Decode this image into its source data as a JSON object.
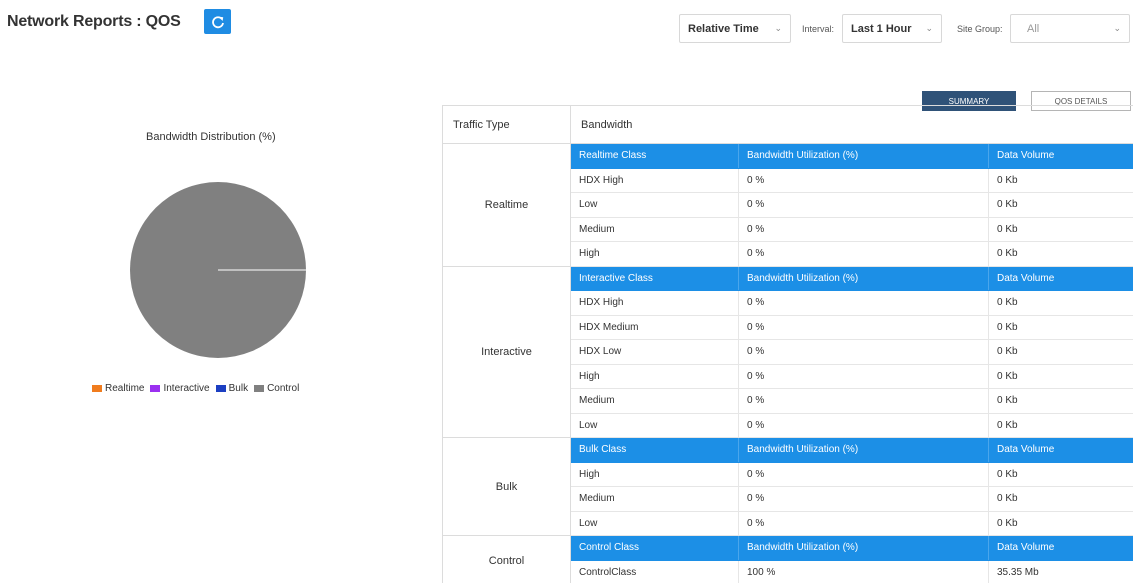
{
  "header": {
    "title": "Network Reports : QOS",
    "refresh_icon": "refresh-icon"
  },
  "filters": {
    "time_mode": "Relative Time",
    "interval_label": "Interval:",
    "interval_value": "Last 1 Hour",
    "site_group_label": "Site Group:",
    "site_group_value": "All"
  },
  "view_buttons": {
    "summary": "SUMMARY",
    "qos_details": "QOS DETAILS"
  },
  "chart": {
    "title": "Bandwidth Distribution (%)",
    "legend": [
      {
        "label": "Realtime",
        "color": "#f07c1e"
      },
      {
        "label": "Interactive",
        "color": "#9b30f0"
      },
      {
        "label": "Bulk",
        "color": "#1c3fc2"
      },
      {
        "label": "Control",
        "color": "#808080"
      }
    ]
  },
  "chart_data": {
    "type": "pie",
    "title": "Bandwidth Distribution (%)",
    "categories": [
      "Realtime",
      "Interactive",
      "Bulk",
      "Control"
    ],
    "values": [
      0,
      0,
      0,
      100
    ],
    "colors": [
      "#f07c1e",
      "#9b30f0",
      "#1c3fc2",
      "#808080"
    ],
    "legend_position": "bottom"
  },
  "table": {
    "headers": {
      "traffic_type": "Traffic Type",
      "bandwidth": "Bandwidth"
    },
    "groups": [
      {
        "name": "Realtime",
        "class_header": [
          "Realtime Class",
          "Bandwidth Utilization (%)",
          "Data Volume"
        ],
        "rows": [
          [
            "HDX High",
            "0 %",
            "0 Kb"
          ],
          [
            "Low",
            "0 %",
            "0 Kb"
          ],
          [
            "Medium",
            "0 %",
            "0 Kb"
          ],
          [
            "High",
            "0 %",
            "0 Kb"
          ]
        ]
      },
      {
        "name": "Interactive",
        "class_header": [
          "Interactive Class",
          "Bandwidth Utilization (%)",
          "Data Volume"
        ],
        "rows": [
          [
            "HDX High",
            "0 %",
            "0 Kb"
          ],
          [
            "HDX Medium",
            "0 %",
            "0 Kb"
          ],
          [
            "HDX Low",
            "0 %",
            "0 Kb"
          ],
          [
            "High",
            "0 %",
            "0 Kb"
          ],
          [
            "Medium",
            "0 %",
            "0 Kb"
          ],
          [
            "Low",
            "0 %",
            "0 Kb"
          ]
        ]
      },
      {
        "name": "Bulk",
        "class_header": [
          "Bulk Class",
          "Bandwidth Utilization (%)",
          "Data Volume"
        ],
        "rows": [
          [
            "High",
            "0 %",
            "0 Kb"
          ],
          [
            "Medium",
            "0 %",
            "0 Kb"
          ],
          [
            "Low",
            "0 %",
            "0 Kb"
          ]
        ]
      },
      {
        "name": "Control",
        "class_header": [
          "Control Class",
          "Bandwidth Utilization (%)",
          "Data Volume"
        ],
        "rows": [
          [
            "ControlClass",
            "100 %",
            "35.35 Mb"
          ]
        ]
      }
    ]
  }
}
